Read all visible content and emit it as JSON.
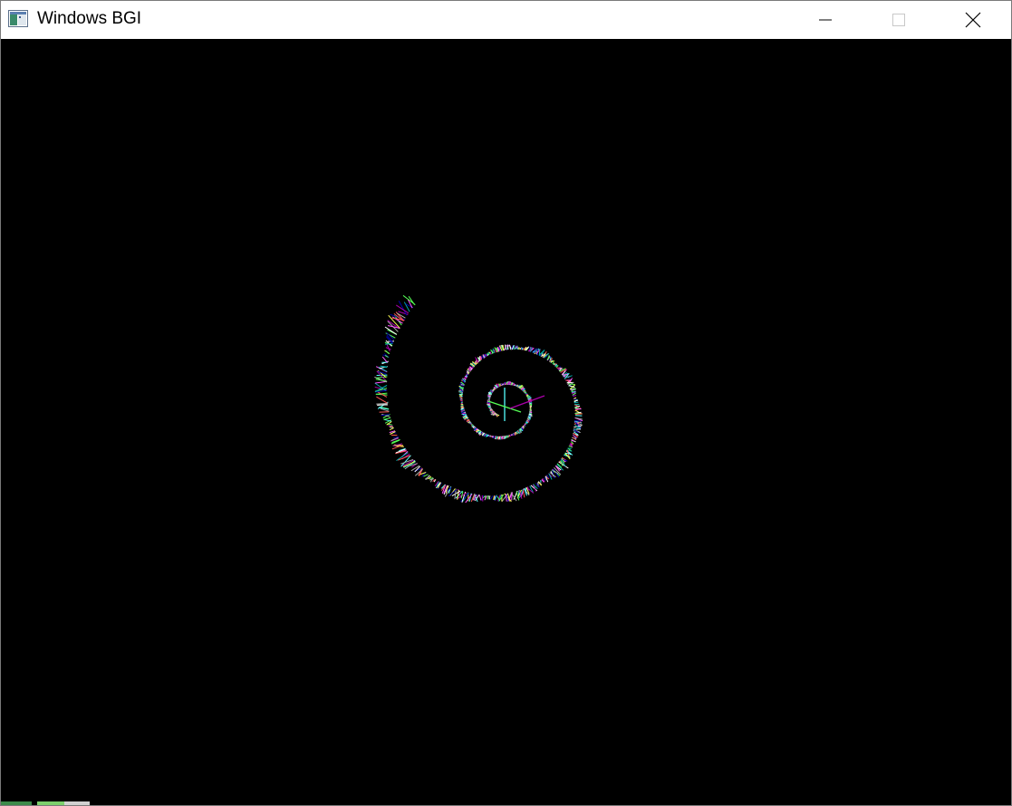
{
  "window": {
    "title": "Windows BGI",
    "icon": "app-window-icon",
    "controls": {
      "minimize": "minimize-icon",
      "maximize": "maximize-icon",
      "close": "close-icon"
    }
  },
  "canvas": {
    "background": "#000000",
    "drawing": "spiral-of-colored-line-fans",
    "palette": [
      "#ff55ff",
      "#55ffff",
      "#ffff55",
      "#ffffff",
      "#55ff55",
      "#aa00aa",
      "#0000aa",
      "#ff5555",
      "#00aaaa",
      "#aaaaaa"
    ]
  }
}
